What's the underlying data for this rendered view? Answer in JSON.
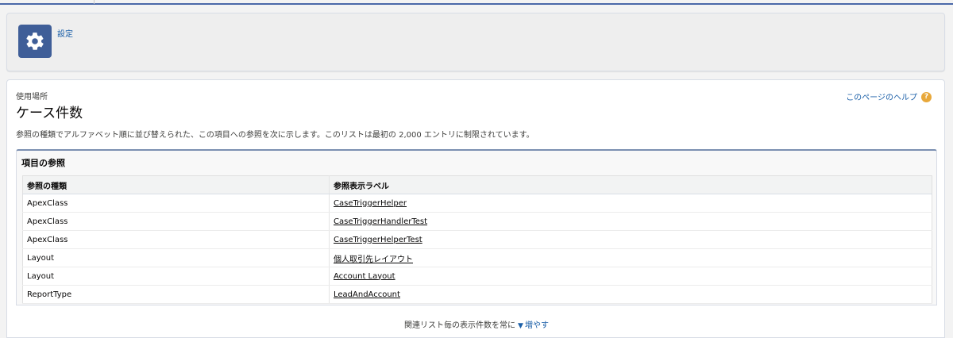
{
  "header": {
    "link_label": "設定",
    "icon": "gear-icon"
  },
  "page": {
    "eyebrow": "使用場所",
    "title": "ケース件数",
    "help_label": "このページのヘルプ",
    "help_icon_glyph": "?",
    "description": "参照の種類でアルファベット順に並び替えられた、この項目への参照を次に示します。このリストは最初の 2,000 エントリに制限されています。"
  },
  "related_list": {
    "title": "項目の参照",
    "columns": [
      "参照の種類",
      "参照表示ラベル"
    ],
    "rows": [
      {
        "type": "ApexClass",
        "label": "CaseTriggerHelper"
      },
      {
        "type": "ApexClass",
        "label": "CaseTriggerHandlerTest"
      },
      {
        "type": "ApexClass",
        "label": "CaseTriggerHelperTest"
      },
      {
        "type": "Layout",
        "label": "個人取引先レイアウト"
      },
      {
        "type": "Layout",
        "label": "Account Layout"
      },
      {
        "type": "ReportType",
        "label": "LeadAndAccount"
      }
    ]
  },
  "footer": {
    "text": "関連リスト毎の表示件数を常に",
    "triangle": "▼",
    "link": "増やす"
  },
  "colors": {
    "accent": "#3f5e98",
    "link": "#1b5fa8",
    "help": "#e8a83a"
  }
}
